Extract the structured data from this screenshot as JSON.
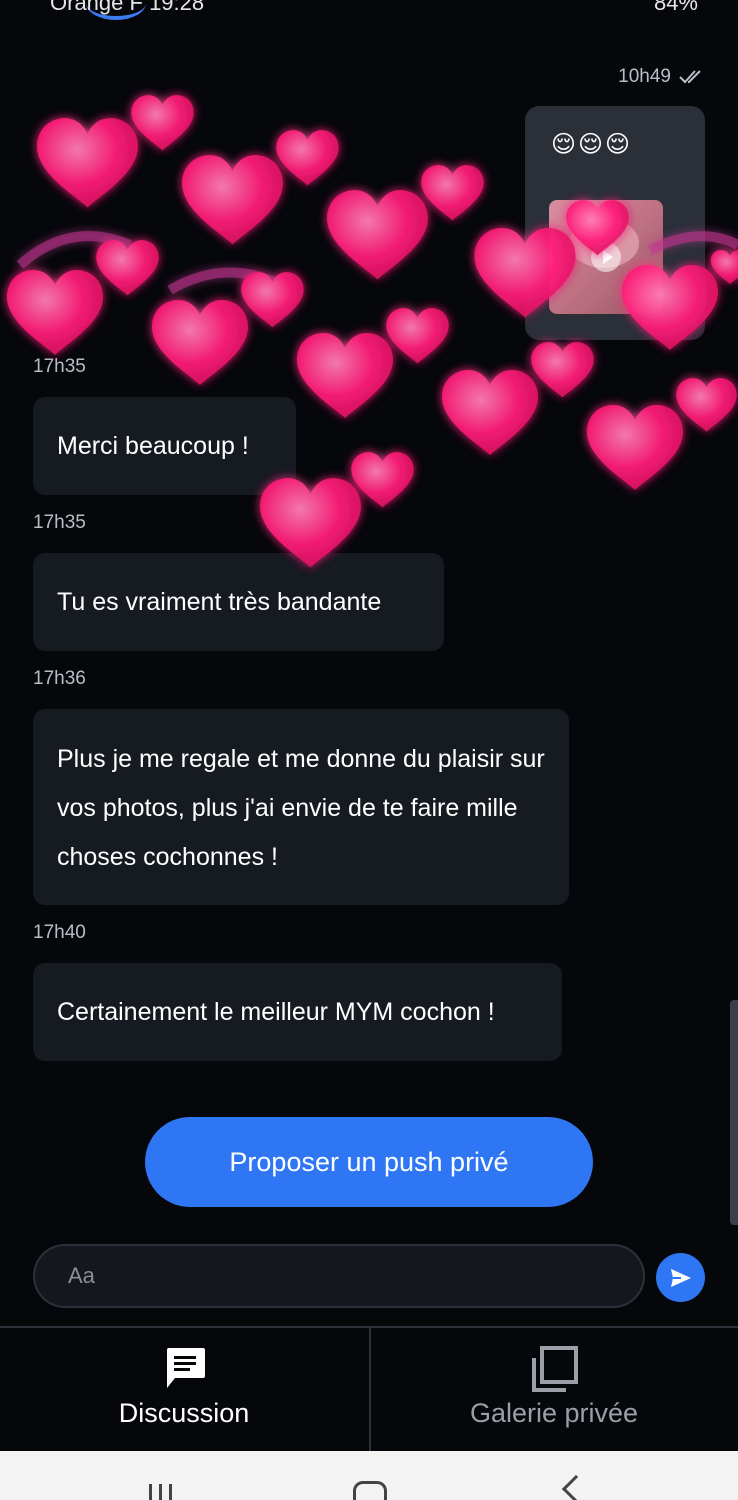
{
  "status_bar": {
    "carrier": "Orange F",
    "time": "19:28",
    "battery": "84%"
  },
  "sent_message": {
    "time": "10h49",
    "emojis": "😌😌😌"
  },
  "messages": [
    {
      "time": "17h35",
      "text": "Merci beaucoup !"
    },
    {
      "time": "17h35",
      "text": "Tu es vraiment très bandante"
    },
    {
      "time": "17h36",
      "text": "Plus je me regale et me donne du plaisir sur vos photos, plus j'ai envie de te faire mille choses cochonnes !"
    },
    {
      "time": "17h40",
      "text": "Certainement le meilleur MYM cochon !"
    }
  ],
  "push_button_label": "Proposer un push privé",
  "composer": {
    "placeholder": "Aa"
  },
  "nav": {
    "discussion_label": "Discussion",
    "gallery_label": "Galerie privée"
  },
  "colors": {
    "accent": "#2e76f4",
    "bubble": "#161a21",
    "background": "#05070b",
    "heart": "#ff1f7a"
  }
}
